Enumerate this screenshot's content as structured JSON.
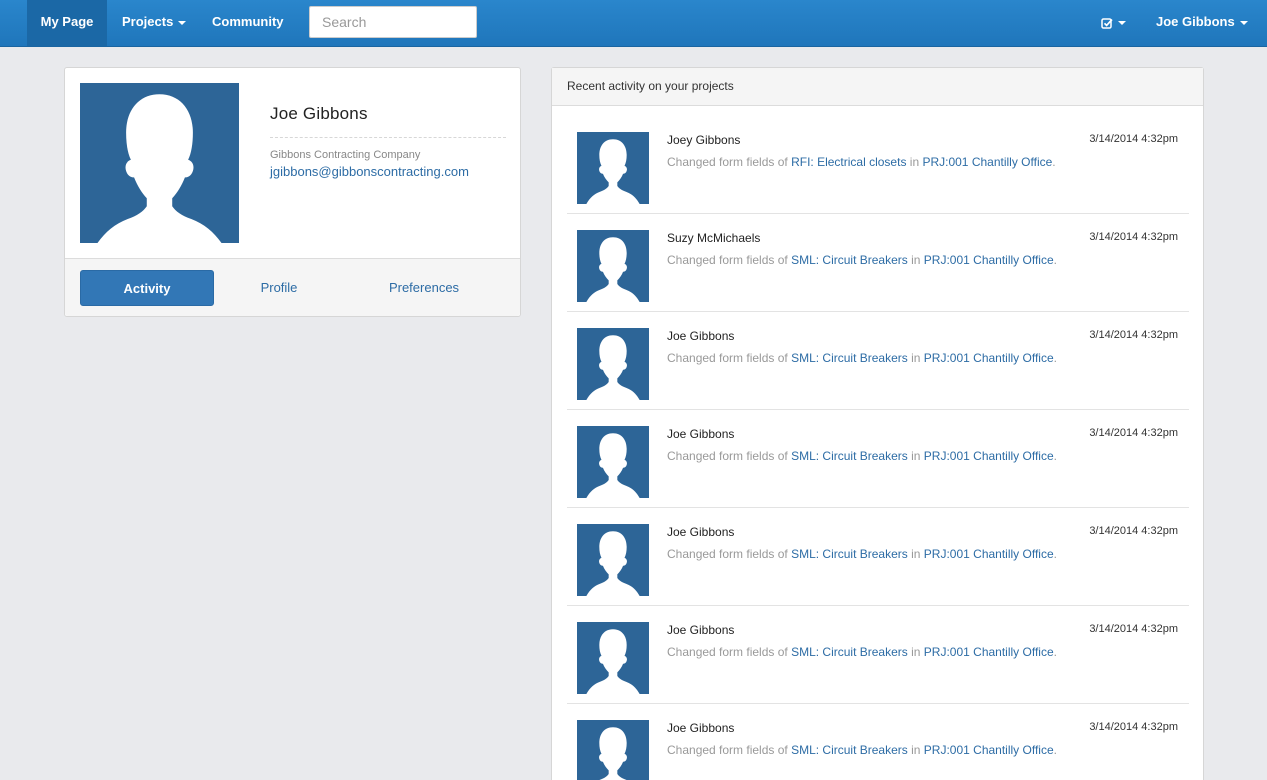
{
  "nav": {
    "my_page": "My Page",
    "projects": "Projects",
    "community": "Community",
    "search_placeholder": "Search",
    "user_menu": "Joe Gibbons",
    "tasks_icon": "checkbox-icon"
  },
  "profile": {
    "name": "Joe Gibbons",
    "company": "Gibbons Contracting Company",
    "email": "jgibbons@gibbonscontracting.com",
    "avatar_icon": "person-silhouette-icon",
    "tabs": [
      {
        "label": "Activity",
        "active": true
      },
      {
        "label": "Profile",
        "active": false
      },
      {
        "label": "Preferences",
        "active": false
      }
    ]
  },
  "activity": {
    "header": "Recent activity on your projects",
    "items": [
      {
        "user": "Joey Gibbons",
        "time": "3/14/2014 4:32pm",
        "prefix": "Changed form fields of ",
        "item": "RFI: Electrical closets",
        "in": " in ",
        "project": "PRJ:001 Chantilly Office",
        "end": "."
      },
      {
        "user": "Suzy McMichaels",
        "time": "3/14/2014 4:32pm",
        "prefix": "Changed form fields of ",
        "item": "SML: Circuit Breakers",
        "in": " in ",
        "project": "PRJ:001 Chantilly Office",
        "end": "."
      },
      {
        "user": "Joe Gibbons",
        "time": "3/14/2014 4:32pm",
        "prefix": "Changed form fields of ",
        "item": "SML: Circuit Breakers",
        "in": " in ",
        "project": "PRJ:001 Chantilly Office",
        "end": "."
      },
      {
        "user": "Joe Gibbons",
        "time": "3/14/2014 4:32pm",
        "prefix": "Changed form fields of ",
        "item": "SML: Circuit Breakers",
        "in": " in ",
        "project": "PRJ:001 Chantilly Office",
        "end": "."
      },
      {
        "user": "Joe Gibbons",
        "time": "3/14/2014 4:32pm",
        "prefix": "Changed form fields of ",
        "item": "SML: Circuit Breakers",
        "in": " in ",
        "project": "PRJ:001 Chantilly Office",
        "end": "."
      },
      {
        "user": "Joe Gibbons",
        "time": "3/14/2014 4:32pm",
        "prefix": "Changed form fields of ",
        "item": "SML: Circuit Breakers",
        "in": " in ",
        "project": "PRJ:001 Chantilly Office",
        "end": "."
      },
      {
        "user": "Joe Gibbons",
        "time": "3/14/2014 4:32pm",
        "prefix": "Changed form fields of ",
        "item": "SML: Circuit Breakers",
        "in": " in ",
        "project": "PRJ:001 Chantilly Office",
        "end": "."
      }
    ]
  },
  "colors": {
    "nav_blue": "#1f76bb",
    "avatar_blue": "#2d6597",
    "link_blue": "#2d6ca5"
  }
}
